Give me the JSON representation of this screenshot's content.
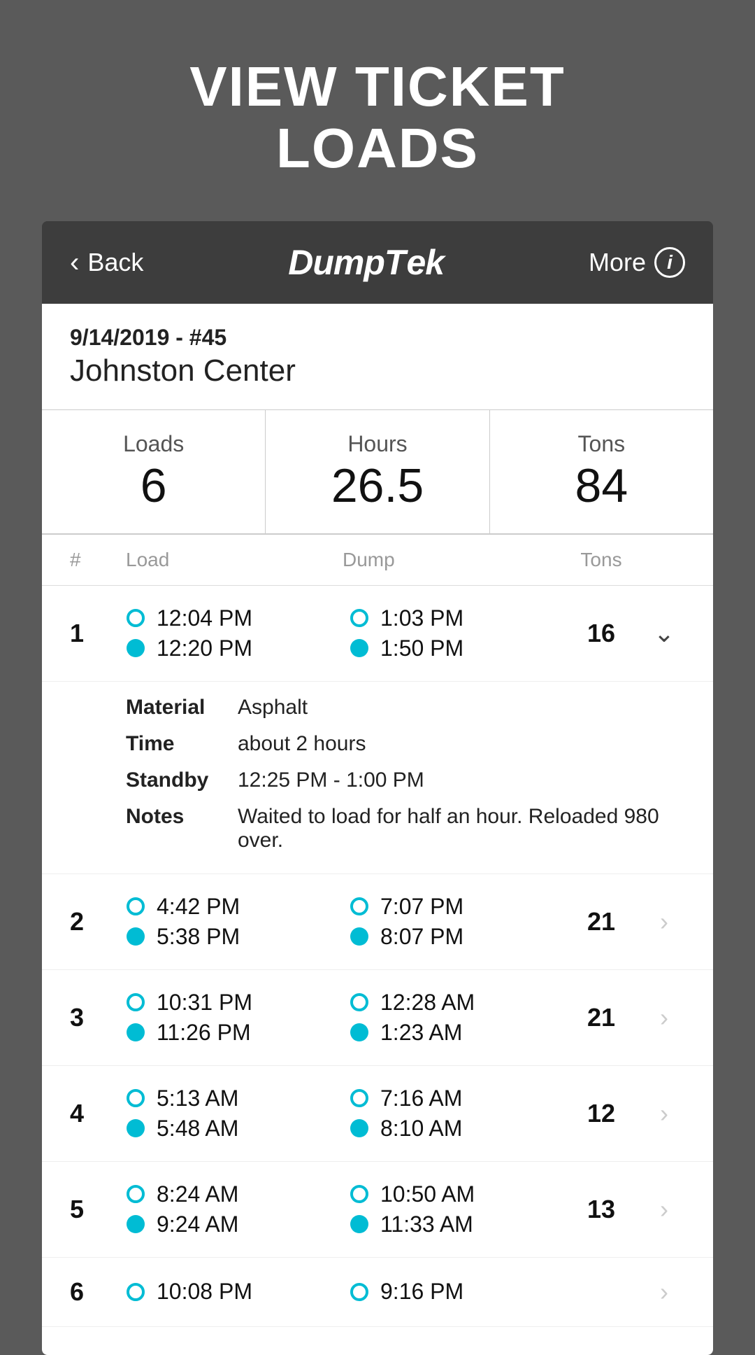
{
  "page": {
    "title_line1": "VIEW TICKET",
    "title_line2": "LOADS"
  },
  "nav": {
    "back_label": "Back",
    "logo": "DumpTek",
    "more_label": "More"
  },
  "ticket": {
    "date_number": "9/14/2019 - #45",
    "name": "Johnston Center"
  },
  "stats": [
    {
      "label": "Loads",
      "value": "6"
    },
    {
      "label": "Hours",
      "value": "26.5"
    },
    {
      "label": "Tons",
      "value": "84"
    }
  ],
  "table_headers": {
    "num": "#",
    "load": "Load",
    "dump": "Dump",
    "tons": "Tons"
  },
  "loads": [
    {
      "num": "1",
      "load_top": "12:04 PM",
      "load_bot": "12:20 PM",
      "dump_top": "1:03 PM",
      "dump_bot": "1:50 PM",
      "tons": "16",
      "expanded": true,
      "material_label": "Material",
      "material_val": "Asphalt",
      "time_label": "Time",
      "time_val": "about 2 hours",
      "standby_label": "Standby",
      "standby_val": "12:25 PM - 1:00 PM",
      "notes_label": "Notes",
      "notes_val": "Waited to load for half an hour. Reloaded 980 over."
    },
    {
      "num": "2",
      "load_top": "4:42 PM",
      "load_bot": "5:38 PM",
      "dump_top": "7:07 PM",
      "dump_bot": "8:07 PM",
      "tons": "21",
      "expanded": false
    },
    {
      "num": "3",
      "load_top": "10:31 PM",
      "load_bot": "11:26 PM",
      "dump_top": "12:28 AM",
      "dump_bot": "1:23 AM",
      "tons": "21",
      "expanded": false
    },
    {
      "num": "4",
      "load_top": "5:13 AM",
      "load_bot": "5:48 AM",
      "dump_top": "7:16 AM",
      "dump_bot": "8:10 AM",
      "tons": "12",
      "expanded": false
    },
    {
      "num": "5",
      "load_top": "8:24 AM",
      "load_bot": "9:24 AM",
      "dump_top": "10:50 AM",
      "dump_bot": "11:33 AM",
      "tons": "13",
      "expanded": false
    },
    {
      "num": "6",
      "load_top": "10:08 PM",
      "load_bot": "",
      "dump_top": "9:16 PM",
      "dump_bot": "",
      "tons": "",
      "expanded": false,
      "partial": true
    }
  ]
}
